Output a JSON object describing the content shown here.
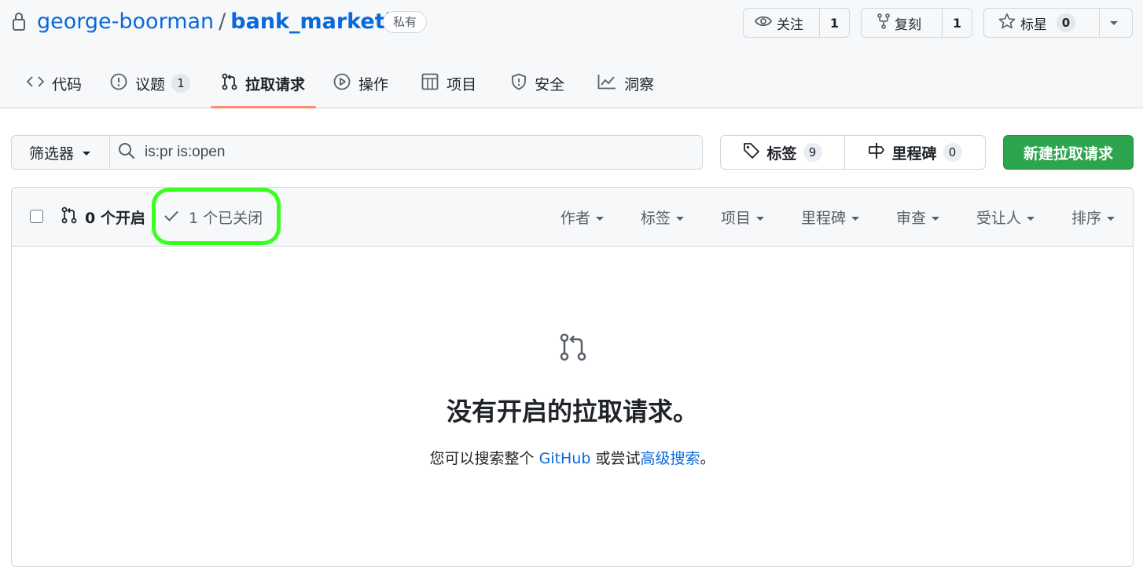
{
  "repo": {
    "owner": "george-boorman",
    "separator": "/",
    "name": "bank_marketing",
    "visibility": "私有"
  },
  "actions": {
    "watch": {
      "label": "关注",
      "count": "1"
    },
    "fork": {
      "label": "复刻",
      "count": "1"
    },
    "star": {
      "label": "标星",
      "count": "0"
    }
  },
  "tabs": [
    {
      "label": "代码",
      "icon": "code-icon"
    },
    {
      "label": "议题",
      "icon": "issue-opened-icon",
      "count": "1"
    },
    {
      "label": "拉取请求",
      "icon": "git-pull-request-icon",
      "active": true
    },
    {
      "label": "操作",
      "icon": "play-icon"
    },
    {
      "label": "项目",
      "icon": "table-icon"
    },
    {
      "label": "安全",
      "icon": "shield-icon"
    },
    {
      "label": "洞察",
      "icon": "graph-icon"
    }
  ],
  "filter": {
    "button_label": "筛选器",
    "search_value": "is:pr is:open"
  },
  "labels_button": {
    "label": "标签",
    "count": "9"
  },
  "milestones_button": {
    "label": "里程碑",
    "count": "0"
  },
  "new_pr_label": "新建拉取请求",
  "list_header": {
    "open_label": "0 个开启",
    "closed_label": "1 个已关闭",
    "menus": [
      "作者",
      "标签",
      "项目",
      "里程碑",
      "审查",
      "受让人",
      "排序"
    ]
  },
  "blankslate": {
    "title": "没有开启的拉取请求。",
    "text_before": "您可以搜索整个 ",
    "github_link": "GitHub",
    "text_middle": " 或尝试",
    "advanced_link": "高级搜索",
    "text_after": "。"
  },
  "colors": {
    "link": "#0969da",
    "primary_button": "#2da44e",
    "active_tab_underline": "#fd8c73",
    "highlight_ring": "#39ff1f"
  }
}
